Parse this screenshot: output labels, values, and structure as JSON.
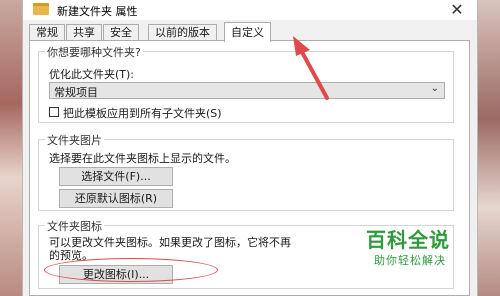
{
  "window": {
    "title": "新建文件夹 属性",
    "close_glyph": "✕"
  },
  "tabs": [
    {
      "label": "常规"
    },
    {
      "label": "共享"
    },
    {
      "label": "安全"
    },
    {
      "label": "以前的版本"
    },
    {
      "label": "自定义"
    }
  ],
  "active_tab": "自定义",
  "sections": {
    "folder_type": {
      "title": "你想要哪种文件夹?",
      "optimize_label": "优化此文件夹(T):",
      "optimize_value": "常规项目",
      "apply_subfolders_label": "把此模板应用到所有子文件夹(S)",
      "apply_subfolders_checked": false
    },
    "folder_pictures": {
      "title": "文件夹图片",
      "description": "选择要在此文件夹图标上显示的文件。",
      "choose_file_button": "选择文件(F)...",
      "restore_default_button": "还原默认图标(R)"
    },
    "folder_icon": {
      "title": "文件夹图标",
      "description_line1": "可以更改文件夹图标。如果更改了图标，它将不再",
      "description_line2": "的预览。",
      "change_icon_button": "更改图标(I)..."
    }
  },
  "watermark": {
    "main": "百科全说",
    "sub": "助你轻松解决"
  },
  "colors": {
    "annotation_red": "#e04a4a",
    "watermark_green": "#2e9b3a"
  }
}
